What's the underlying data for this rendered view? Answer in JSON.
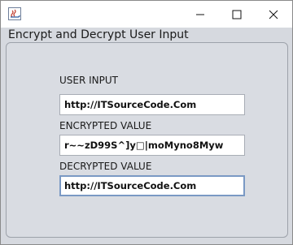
{
  "window": {
    "frame_title": "Encrypt and Decrypt User Input"
  },
  "icons": {
    "app": "java-app-icon",
    "minimize": "minimize-icon",
    "maximize": "maximize-icon",
    "close": "close-icon"
  },
  "form": {
    "user_input_label": "USER INPUT",
    "user_input_value": "http://ITSourceCode.Com",
    "encrypted_label": "ENCRYPTED VALUE",
    "encrypted_value": "r~~zD99S^]y□|moMyno8Myw",
    "decrypted_label": "DECRYPTED VALUE",
    "decrypted_value": "http://ITSourceCode.Com"
  }
}
